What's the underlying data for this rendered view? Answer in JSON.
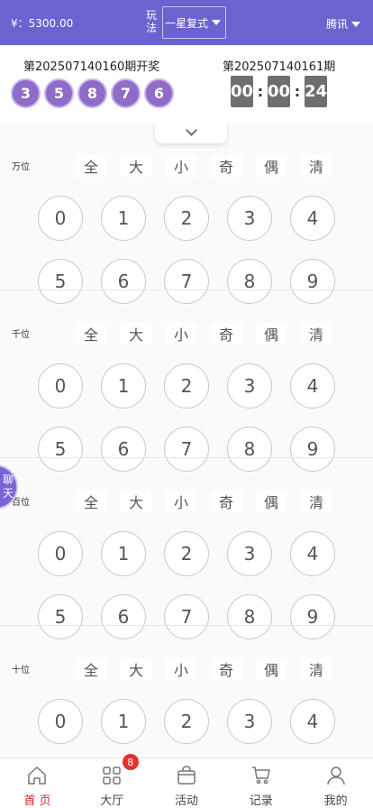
{
  "header": {
    "balance": "¥：5300.00",
    "play_label": "玩法",
    "play_mode": "一星复式",
    "source": "腾讯"
  },
  "draw": {
    "prev_issue": "第202507140160期开奖",
    "prev_numbers": [
      "3",
      "5",
      "8",
      "7",
      "6"
    ],
    "next_issue": "第202507140161期",
    "countdown": {
      "hours": "00",
      "minutes": "00",
      "seconds": "24",
      "separator": ":"
    }
  },
  "filters": [
    "全",
    "大",
    "小",
    "奇",
    "偶",
    "清"
  ],
  "digits": [
    "0",
    "1",
    "2",
    "3",
    "4",
    "5",
    "6",
    "7",
    "8",
    "9"
  ],
  "positions": [
    {
      "label": "万位"
    },
    {
      "label": "千位"
    },
    {
      "label": "百位"
    },
    {
      "label": "十位"
    }
  ],
  "chat": {
    "line1": "聊",
    "line2": "天"
  },
  "tabs": [
    {
      "label": "首 页",
      "icon": "home-icon",
      "active": true
    },
    {
      "label": "大厅",
      "icon": "grid-icon",
      "badge": "8"
    },
    {
      "label": "活动",
      "icon": "bag-icon"
    },
    {
      "label": "记录",
      "icon": "cart-icon"
    },
    {
      "label": "我的",
      "icon": "user-icon"
    }
  ],
  "colors": {
    "primary": "#6b63cf",
    "ball": "#8e6cc8",
    "timer": "#6e6e6e",
    "active_tab": "#d32828",
    "badge": "#e5312b"
  }
}
